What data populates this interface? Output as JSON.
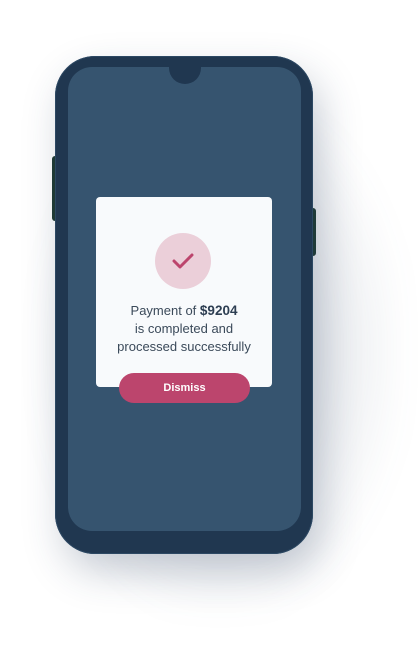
{
  "dialog": {
    "icon": "checkmark-icon",
    "message_prefix": "Payment of",
    "amount": "$9204",
    "message_line2": "is completed and",
    "message_line3": "processed successfully",
    "dismiss_label": "Dismiss"
  },
  "colors": {
    "phone_body": "#203750",
    "screen": "#36546f",
    "card": "#f8fafc",
    "accent": "#bc456d",
    "icon_bg": "#ebcfd9"
  }
}
